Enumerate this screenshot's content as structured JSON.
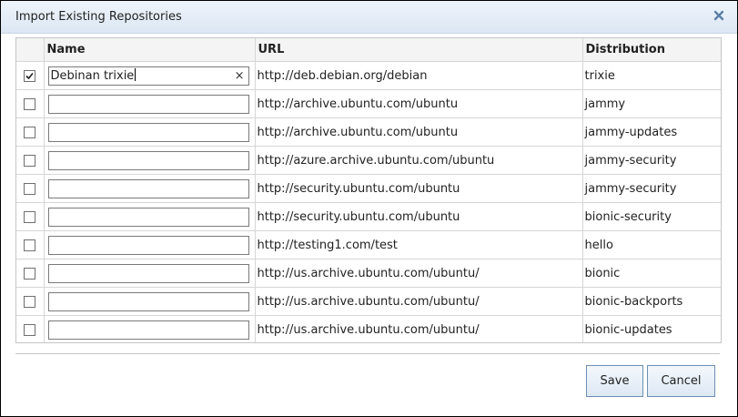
{
  "dialog": {
    "title": "Import Existing Repositories",
    "close_icon": "close-icon"
  },
  "table": {
    "headers": {
      "select": "",
      "name": "Name",
      "url": "URL",
      "distribution": "Distribution"
    },
    "rows": [
      {
        "checked": true,
        "name": "Debinan trixie",
        "url": "http://deb.debian.org/debian",
        "distribution": "trixie"
      },
      {
        "checked": false,
        "name": "",
        "url": "http://archive.ubuntu.com/ubuntu",
        "distribution": "jammy"
      },
      {
        "checked": false,
        "name": "",
        "url": "http://archive.ubuntu.com/ubuntu",
        "distribution": "jammy-updates"
      },
      {
        "checked": false,
        "name": "",
        "url": "http://azure.archive.ubuntu.com/ubuntu",
        "distribution": "jammy-security"
      },
      {
        "checked": false,
        "name": "",
        "url": "http://security.ubuntu.com/ubuntu",
        "distribution": "jammy-security"
      },
      {
        "checked": false,
        "name": "",
        "url": "http://security.ubuntu.com/ubuntu",
        "distribution": "bionic-security"
      },
      {
        "checked": false,
        "name": "",
        "url": "http://testing1.com/test",
        "distribution": "hello"
      },
      {
        "checked": false,
        "name": "",
        "url": "http://us.archive.ubuntu.com/ubuntu/",
        "distribution": "bionic"
      },
      {
        "checked": false,
        "name": "",
        "url": "http://us.archive.ubuntu.com/ubuntu/",
        "distribution": "bionic-backports"
      },
      {
        "checked": false,
        "name": "",
        "url": "http://us.archive.ubuntu.com/ubuntu/",
        "distribution": "bionic-updates"
      }
    ],
    "clear_glyph": "×"
  },
  "buttons": {
    "save": "Save",
    "cancel": "Cancel"
  }
}
